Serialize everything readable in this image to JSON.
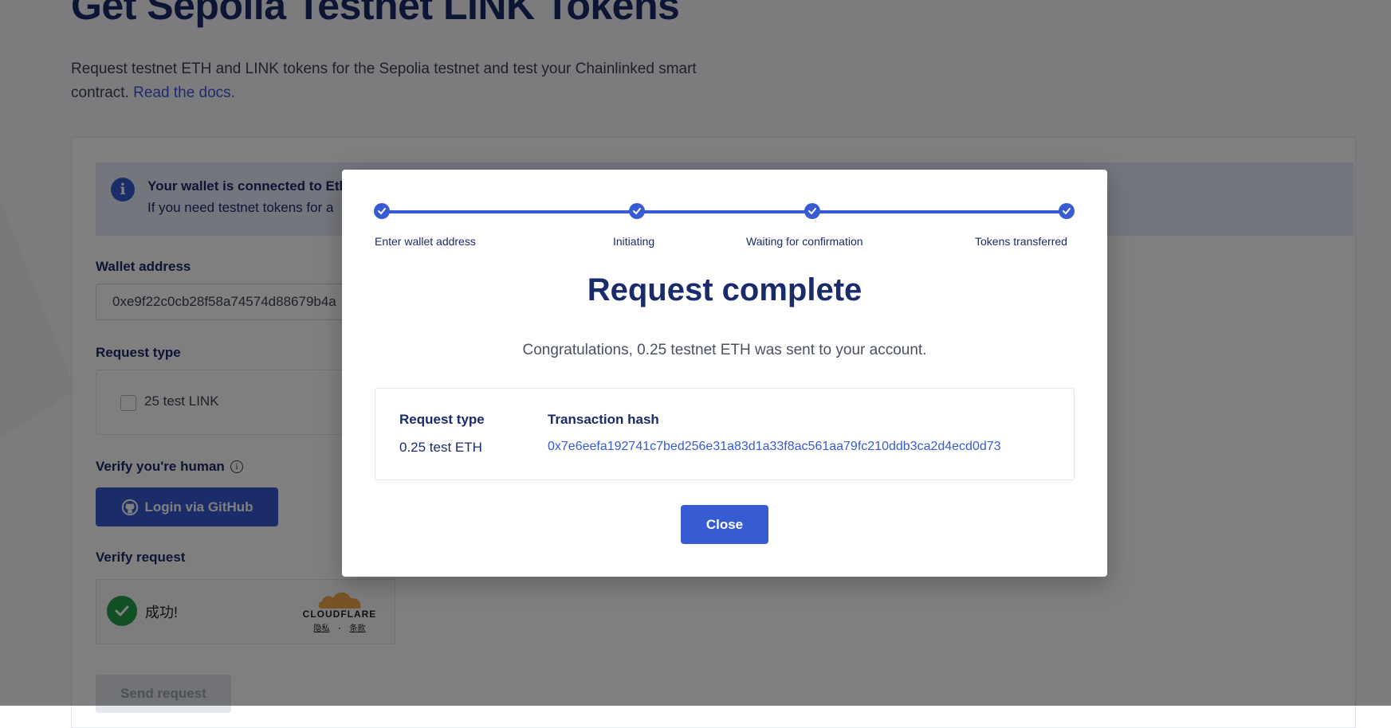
{
  "page": {
    "title": "Get Sepolia Testnet LINK Tokens",
    "subtitle": "Request testnet ETH and LINK tokens for the Sepolia testnet and test your Chainlinked smart contract.",
    "docs_link": "Read the docs.",
    "banner": {
      "line1": "Your wallet is connected to Eth",
      "line2": "If you need testnet tokens for a"
    },
    "wallet_label": "Wallet address",
    "wallet_value": "0xe9f22c0cb28f58a74574d88679b4a",
    "request_type_label": "Request type",
    "link_option": "25 test LINK",
    "verify_human_label": "Verify you're human",
    "github_button": "Login via GitHub",
    "verify_request_label": "Verify request",
    "captcha": {
      "success_text": "成功!",
      "brand": "CLOUDFLARE",
      "privacy": "隐私",
      "separator": "·",
      "terms": "条款"
    },
    "send_button": "Send request"
  },
  "modal": {
    "steps": [
      {
        "label": "Enter wallet address",
        "done": true
      },
      {
        "label": "Initiating",
        "done": true
      },
      {
        "label": "Waiting for confirmation",
        "done": true
      },
      {
        "label": "Tokens transferred",
        "done": true
      }
    ],
    "title": "Request complete",
    "message": "Congratulations, 0.25 testnet ETH was sent to your account.",
    "request_type_header": "Request type",
    "transaction_hash_header": "Transaction hash",
    "request_type_value": "0.25 test ETH",
    "transaction_hash_value": "0x7e6eefa192741c7bed256e31a83d1a33f8ac561aa79fc210ddb3ca2d4ecd0d73",
    "close_button": "Close"
  },
  "colors": {
    "accent": "#375bd2",
    "navy": "#1a2b6b",
    "success_green": "#22a148"
  }
}
